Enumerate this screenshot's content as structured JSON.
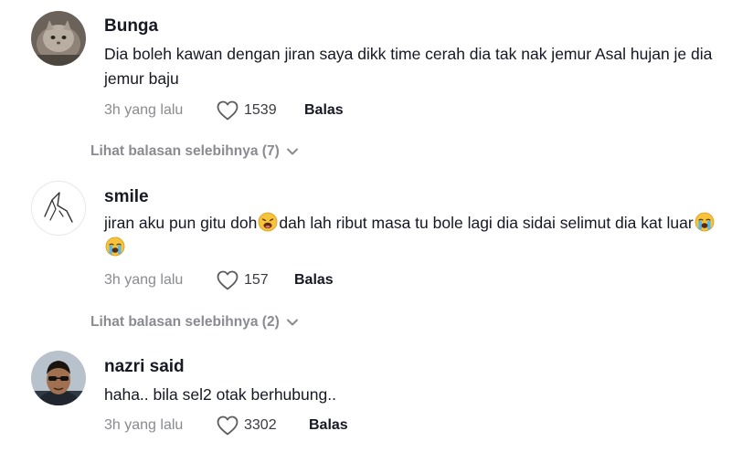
{
  "comments": [
    {
      "username": "Bunga",
      "text": "Dia boleh kawan dengan jiran saya dikk time cerah dia tak nak jemur Asal hujan je dia jemur baju",
      "time": "3h yang lalu",
      "likes": "1539",
      "reply_label": "Balas",
      "view_more": "Lihat balasan selebihnya (7)"
    },
    {
      "username": "smile",
      "text_before": "jiran aku pun gitu doh",
      "text_after": "dah lah ribut masa tu bole lagi dia sidai selimut dia kat luar",
      "time": "3h yang lalu",
      "likes": "157",
      "reply_label": "Balas",
      "view_more": "Lihat balasan selebihnya (2)"
    },
    {
      "username": "nazri said",
      "text": "haha.. bila sel2 otak berhubung..",
      "time": "3h yang lalu",
      "likes": "3302",
      "reply_label": "Balas"
    }
  ],
  "icons": {
    "like": "heart-outline-icon",
    "expand": "chevron-down-icon",
    "emoji_1": "weary-face-emoji",
    "emoji_2": "loudly-crying-face-emoji"
  },
  "colors": {
    "text_primary": "#161823",
    "text_secondary": "#8a8b91",
    "background": "#ffffff"
  }
}
